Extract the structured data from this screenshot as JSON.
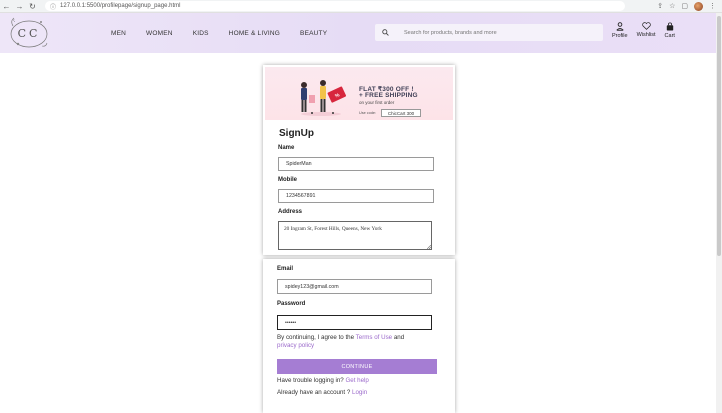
{
  "browser": {
    "url": "127.0.0.1:5500/profilepage/signup_page.html"
  },
  "header": {
    "logo": "CC",
    "nav": [
      "MEN",
      "WOMEN",
      "KIDS",
      "HOME & LIVING",
      "BEAUTY"
    ],
    "search_placeholder": "Search for products, brands and more",
    "actions": {
      "profile": "Profile",
      "wishlist": "Wishlist",
      "cart": "Cart"
    }
  },
  "banner": {
    "title": "FLAT ₹300 OFF !",
    "subtitle": "+ FREE SHIPPING",
    "note": "on your first order",
    "code_label": "Use code:",
    "code": "ChicCart 300"
  },
  "form": {
    "title": "SignUp",
    "name_label": "Name",
    "name_value": "SpiderMan",
    "mobile_label": "Mobile",
    "mobile_value": "1234567891",
    "address_label": "Address",
    "address_value": "20 Ingram St, Forest Hills, Queens, New York",
    "email_label": "Email",
    "email_value": "spidey123@gmail.com",
    "password_label": "Password",
    "password_value": "••••••",
    "consent_prefix": "By continuing, I agree to the ",
    "terms_link": "Terms of Use",
    "consent_and": " and",
    "privacy_link": "privacy policy",
    "continue_label": "CONTINUE",
    "trouble_text": "Have trouble logging in? ",
    "help_link": "Get help",
    "account_text": "Already have an account ? ",
    "login_link": "Login"
  },
  "colors": {
    "accent": "#a57dd3",
    "link": "#9b6acb",
    "header_bg": "#e6dcf5"
  }
}
